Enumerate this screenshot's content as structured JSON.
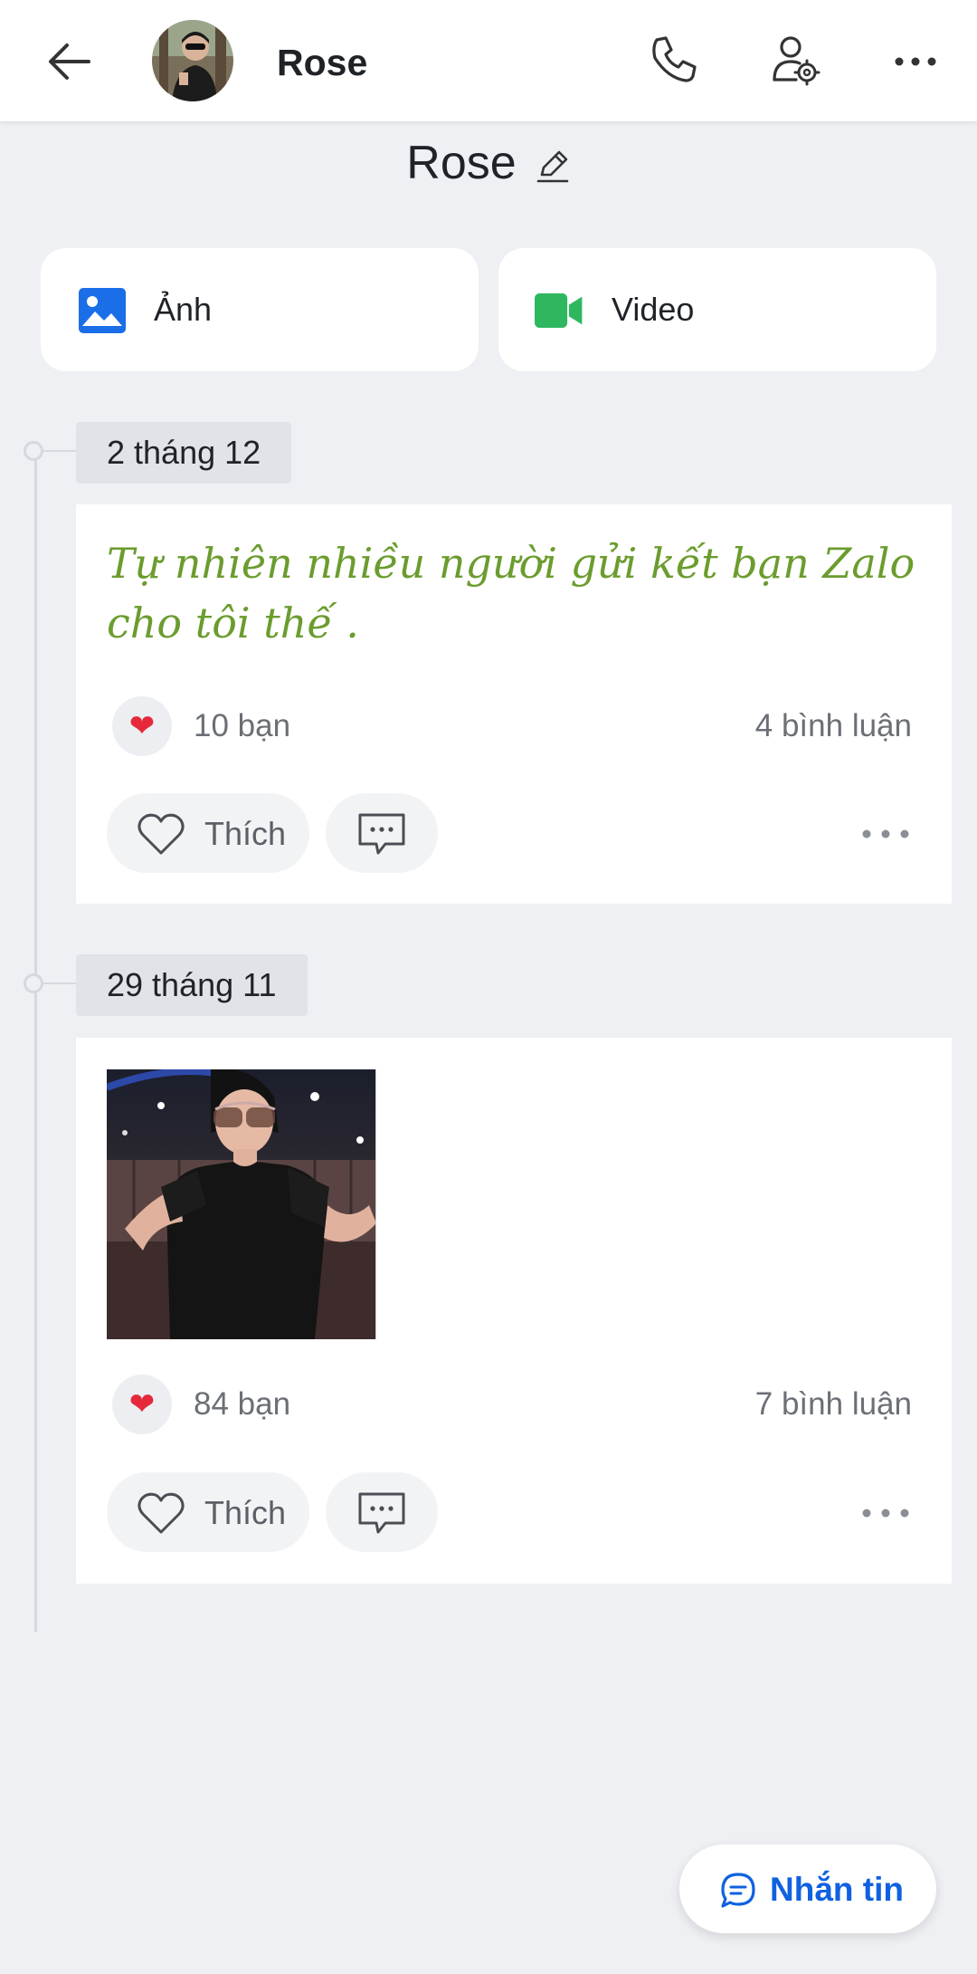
{
  "header": {
    "name": "Rose",
    "icons": [
      "back-arrow-icon",
      "phone-icon",
      "user-settings-icon",
      "more-icon"
    ]
  },
  "profile": {
    "name": "Rose"
  },
  "media_buttons": {
    "photo_label": "Ảnh",
    "video_label": "Video"
  },
  "posts": [
    {
      "date": "2 tháng 12",
      "text": "Tự nhiên nhiều người gửi kết bạn Zalo cho tôi thế .",
      "reactions": "10 bạn",
      "comments": "4 bình luận",
      "like_label": "Thích"
    },
    {
      "date": "29 tháng 11",
      "reactions": "84 bạn",
      "comments": "7 bình luận",
      "like_label": "Thích"
    }
  ],
  "message_button": {
    "label": "Nhắn tin"
  },
  "colors": {
    "accent_blue": "#1061e0",
    "video_green": "#2fb760",
    "post_text_green": "#6b9c2e",
    "heart_red": "#e5293b"
  }
}
